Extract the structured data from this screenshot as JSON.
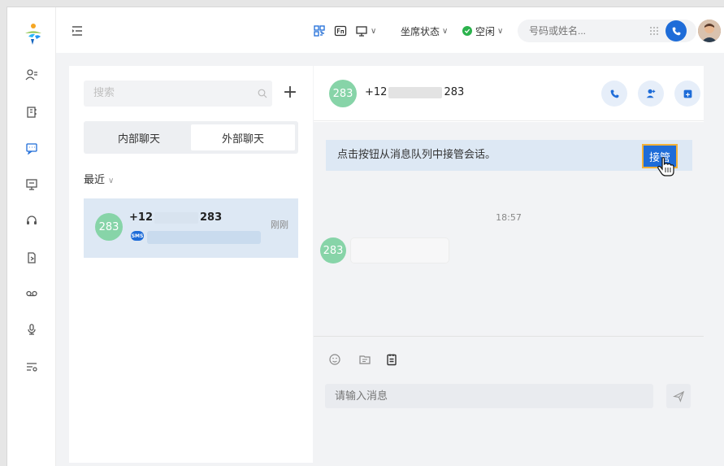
{
  "topbar": {
    "queue_status_label": "坐席状态",
    "presence_label": "空闲",
    "search_placeholder": "号码或姓名..."
  },
  "chat_list": {
    "search_placeholder": "搜索",
    "tabs": [
      {
        "label": "内部聊天",
        "active": false
      },
      {
        "label": "外部聊天",
        "active": true
      }
    ],
    "filter_label": "最近",
    "conversations": [
      {
        "badge": "283",
        "name_prefix": "+12",
        "name_suffix": "283",
        "time": "刚刚",
        "channel": "SMS"
      }
    ]
  },
  "chat": {
    "badge": "283",
    "title_prefix": "+12",
    "title_suffix": "283",
    "banner_text": "点击按钮从消息队列中接管会话。",
    "take_over_label": "接管",
    "timestamp": "18:57",
    "message_badge": "283",
    "input_placeholder": "请输入消息"
  },
  "colors": {
    "accent": "#1e6cd8",
    "badge_green": "#87d4a8",
    "status_green": "#2bb24c",
    "highlight_border": "#f2b23a"
  }
}
